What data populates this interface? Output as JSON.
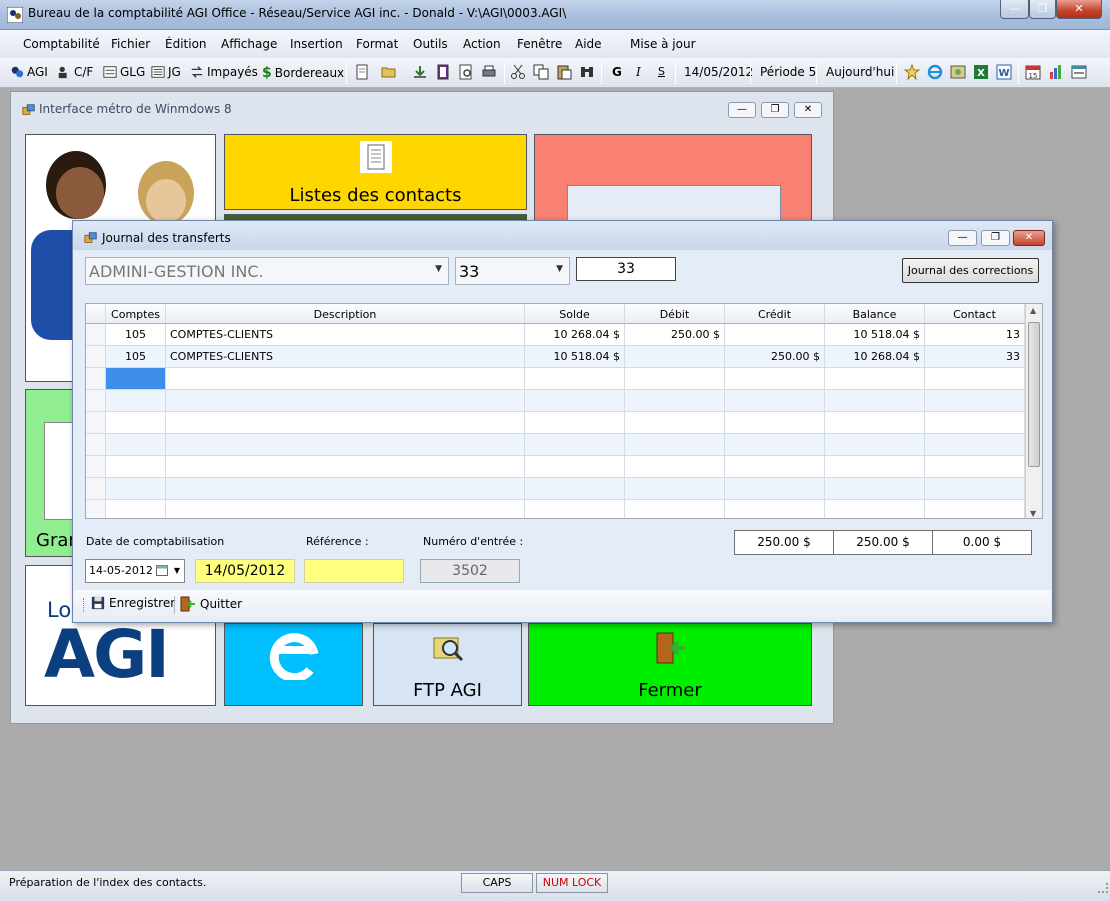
{
  "app": {
    "title": "Bureau de la comptabilité AGI Office - Réseau/Service AGI inc. - Donald - V:\\AGI\\0003.AGI\\",
    "caption_buttons": {
      "minimize": "—",
      "restore": "❐",
      "close": "✕"
    }
  },
  "menu": {
    "items": [
      "Comptabilité",
      "Fichier",
      "Édition",
      "Affichage",
      "Insertion",
      "Format",
      "Outils",
      "Action",
      "Fenêtre",
      "Aide",
      "Mise à jour"
    ]
  },
  "toolbar": {
    "agi": "AGI",
    "cf": "C/F",
    "glg": "GLG",
    "jg": "JG",
    "impayes": "Impayés",
    "bordereaux": "Bordereaux",
    "bold": "G",
    "italic": "I",
    "underline": "S",
    "date": "14/05/2012",
    "periode": "Période 5",
    "aujourdhui": "Aujourd'hui"
  },
  "metro": {
    "title": "Interface métro de Winmdows 8",
    "tiles": {
      "contacts": "Listes des contacts",
      "gran": "Gran",
      "lo": "Lo",
      "agi_logo": "AGI",
      "ftp": "FTP AGI",
      "fermer": "Fermer"
    },
    "colors": {
      "contacts": "#ffd700",
      "salmon": "#fa8072",
      "green_light": "#90ee90",
      "blue": "#00bfff",
      "ftp": "#d6e4f3",
      "fermer": "#00ee00",
      "agi_blue": "#0c3f7f"
    }
  },
  "journal": {
    "title": "Journal des transferts",
    "company": "ADMINI-GESTION INC.",
    "contact_select": "33",
    "contact_field": "33",
    "corrections_button": "Journal des corrections",
    "columns": [
      "Comptes",
      "Description",
      "Solde",
      "Débit",
      "Crédit",
      "Balance",
      "Contact"
    ],
    "rows": [
      {
        "compte": "105",
        "description": "COMPTES-CLIENTS",
        "solde": "10 268.04 $",
        "debit": "250.00 $",
        "credit": "",
        "balance": "10 518.04 $",
        "contact": "13"
      },
      {
        "compte": "105",
        "description": "COMPTES-CLIENTS",
        "solde": "10 518.04 $",
        "debit": "",
        "credit": "250.00 $",
        "balance": "10 268.04 $",
        "contact": "33"
      }
    ],
    "date_label": "Date de comptabilisation",
    "date_picker": "14-05-2012",
    "date_display": "14/05/2012",
    "reference_label": "Référence :",
    "reference_value": "",
    "entry_label": "Numéro d'entrée :",
    "entry_value": "3502",
    "totals": {
      "debit": "250.00 $",
      "credit": "250.00 $",
      "balance": "0.00 $"
    },
    "save_button": "Enregistrer",
    "quit_button": "Quitter"
  },
  "status": {
    "message": "Préparation de l'index des contacts.",
    "caps": "CAPS",
    "numlock": "NUM LOCK",
    "numlock_color": "#d40000"
  }
}
